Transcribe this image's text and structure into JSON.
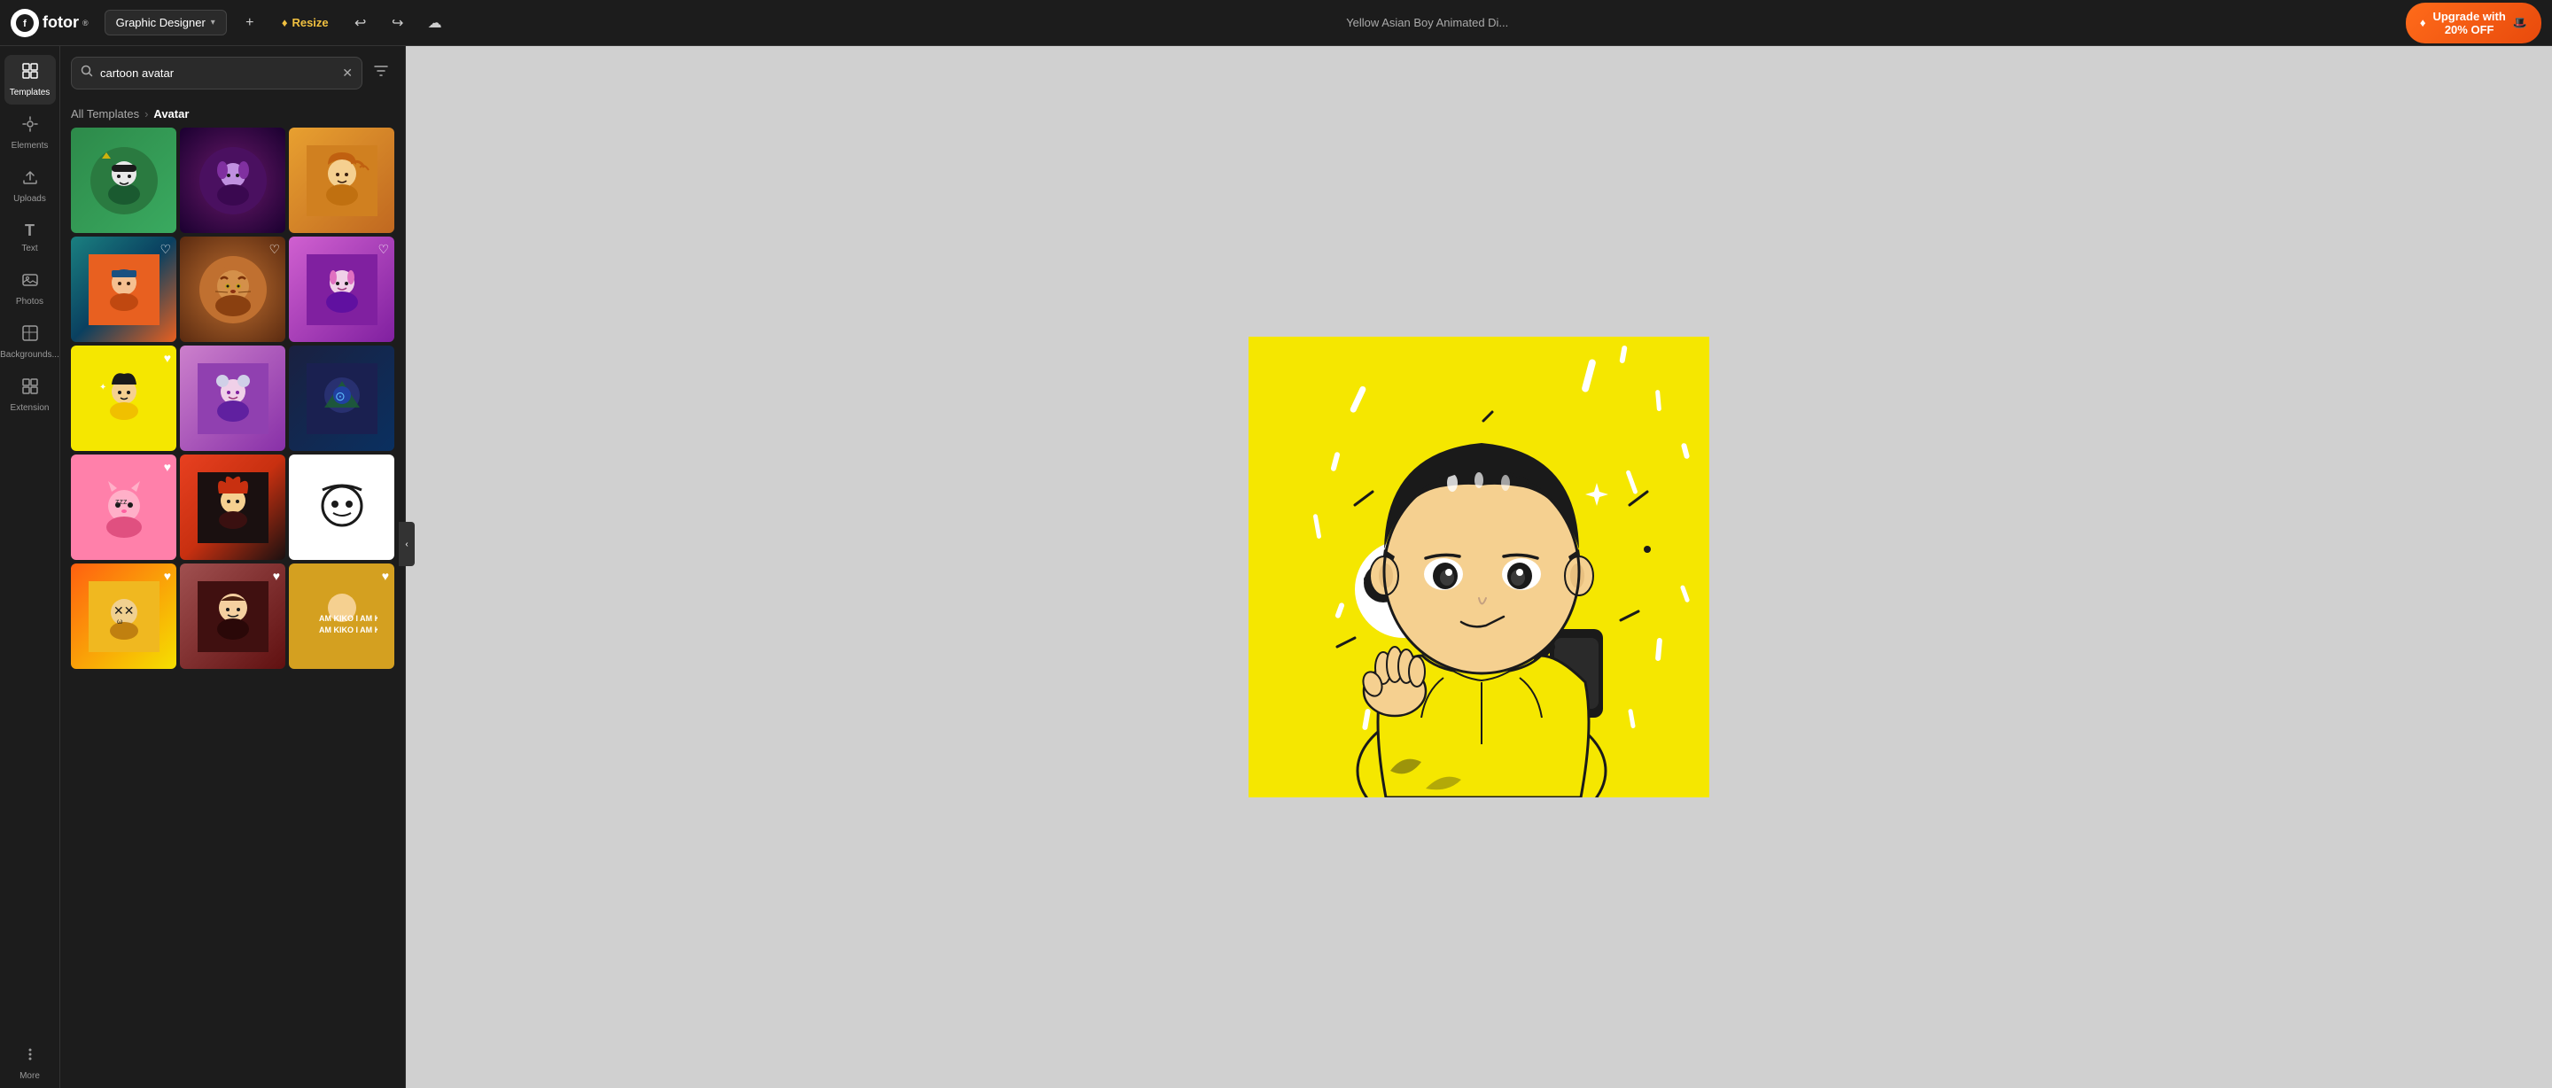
{
  "navbar": {
    "logo": "fotor",
    "logo_sup": "®",
    "designer_label": "Graphic Designer",
    "resize_label": "Resize",
    "doc_title": "Yellow Asian Boy Animated Di...",
    "upgrade_label": "Upgrade with\n20% OFF"
  },
  "left_sidebar": {
    "items": [
      {
        "id": "templates",
        "icon": "⊞",
        "label": "Templates",
        "active": true
      },
      {
        "id": "elements",
        "icon": "✦",
        "label": "Elements"
      },
      {
        "id": "uploads",
        "icon": "↑",
        "label": "Uploads"
      },
      {
        "id": "text",
        "icon": "T",
        "label": "Text"
      },
      {
        "id": "photos",
        "icon": "🖼",
        "label": "Photos"
      },
      {
        "id": "backgrounds",
        "icon": "▦",
        "label": "Backgrounds..."
      },
      {
        "id": "extension",
        "icon": "⊞",
        "label": "Extension"
      },
      {
        "id": "more",
        "icon": "•••",
        "label": "More"
      }
    ]
  },
  "templates_panel": {
    "search_placeholder": "cartoon avatar",
    "breadcrumb_parent": "All Templates",
    "breadcrumb_current": "Avatar",
    "filter_icon": "⊟"
  },
  "templates": [
    {
      "id": 1,
      "class": "t1",
      "emoji": "🧍",
      "has_heart": false
    },
    {
      "id": 2,
      "class": "t2",
      "emoji": "🧝",
      "has_heart": false
    },
    {
      "id": 3,
      "class": "t3",
      "emoji": "🦊",
      "has_heart": false
    },
    {
      "id": 4,
      "class": "t4",
      "emoji": "🧒",
      "has_heart": true
    },
    {
      "id": 5,
      "class": "t5",
      "emoji": "🐯",
      "has_heart": true
    },
    {
      "id": 6,
      "class": "t6",
      "emoji": "💜",
      "has_heart": true
    },
    {
      "id": 7,
      "class": "t7",
      "emoji": "🧑",
      "has_heart": true
    },
    {
      "id": 8,
      "class": "t8",
      "emoji": "🎀",
      "has_heart": false
    },
    {
      "id": 9,
      "class": "t9",
      "emoji": "🛡",
      "has_heart": false
    },
    {
      "id": 10,
      "class": "t10",
      "emoji": "🐱",
      "has_heart": true
    },
    {
      "id": 11,
      "class": "t11",
      "emoji": "🔥",
      "has_heart": false
    },
    {
      "id": 12,
      "class": "t12",
      "emoji": "⭕",
      "has_heart": true
    },
    {
      "id": 13,
      "class": "t13",
      "emoji": "💀",
      "has_heart": true
    },
    {
      "id": 14,
      "class": "t14",
      "emoji": "👤",
      "has_heart": true
    },
    {
      "id": 15,
      "class": "t15",
      "emoji": "🎭",
      "has_heart": true
    }
  ],
  "canvas": {
    "bg_color": "#f5e700"
  }
}
